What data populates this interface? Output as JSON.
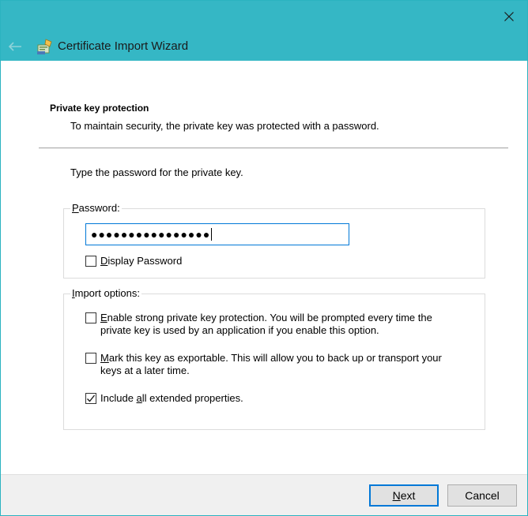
{
  "window": {
    "title": "Certificate Import Wizard",
    "accent_color": "#35b7c5"
  },
  "page": {
    "heading": "Private key protection",
    "description": "To maintain security, the private key was protected with a password.",
    "instruction": "Type the password for the private key."
  },
  "password_group": {
    "legend_prefix": "",
    "legend_accel": "P",
    "legend_rest": "assword:",
    "value_masked": "●●●●●●●●●●●●●●●●",
    "display_password": {
      "accel": "D",
      "rest": "isplay Password",
      "checked": false
    }
  },
  "import_options": {
    "legend_accel": "I",
    "legend_rest": "mport options:",
    "options": [
      {
        "accel": "E",
        "rest": "nable strong private key protection. You will be prompted every time the private key is used by an application if you enable this option.",
        "checked": false
      },
      {
        "accel": "M",
        "rest": "ark this key as exportable. This will allow you to back up or transport your keys at a later time.",
        "checked": false
      },
      {
        "prefix": "Include ",
        "accel": "a",
        "rest": "ll extended properties.",
        "checked": true
      }
    ]
  },
  "buttons": {
    "next_accel": "N",
    "next_rest": "ext",
    "cancel": "Cancel"
  },
  "icons": {
    "close": "close-icon",
    "back": "back-arrow-icon",
    "wizard": "certificate-wizard-icon",
    "check": "checkmark-icon"
  }
}
